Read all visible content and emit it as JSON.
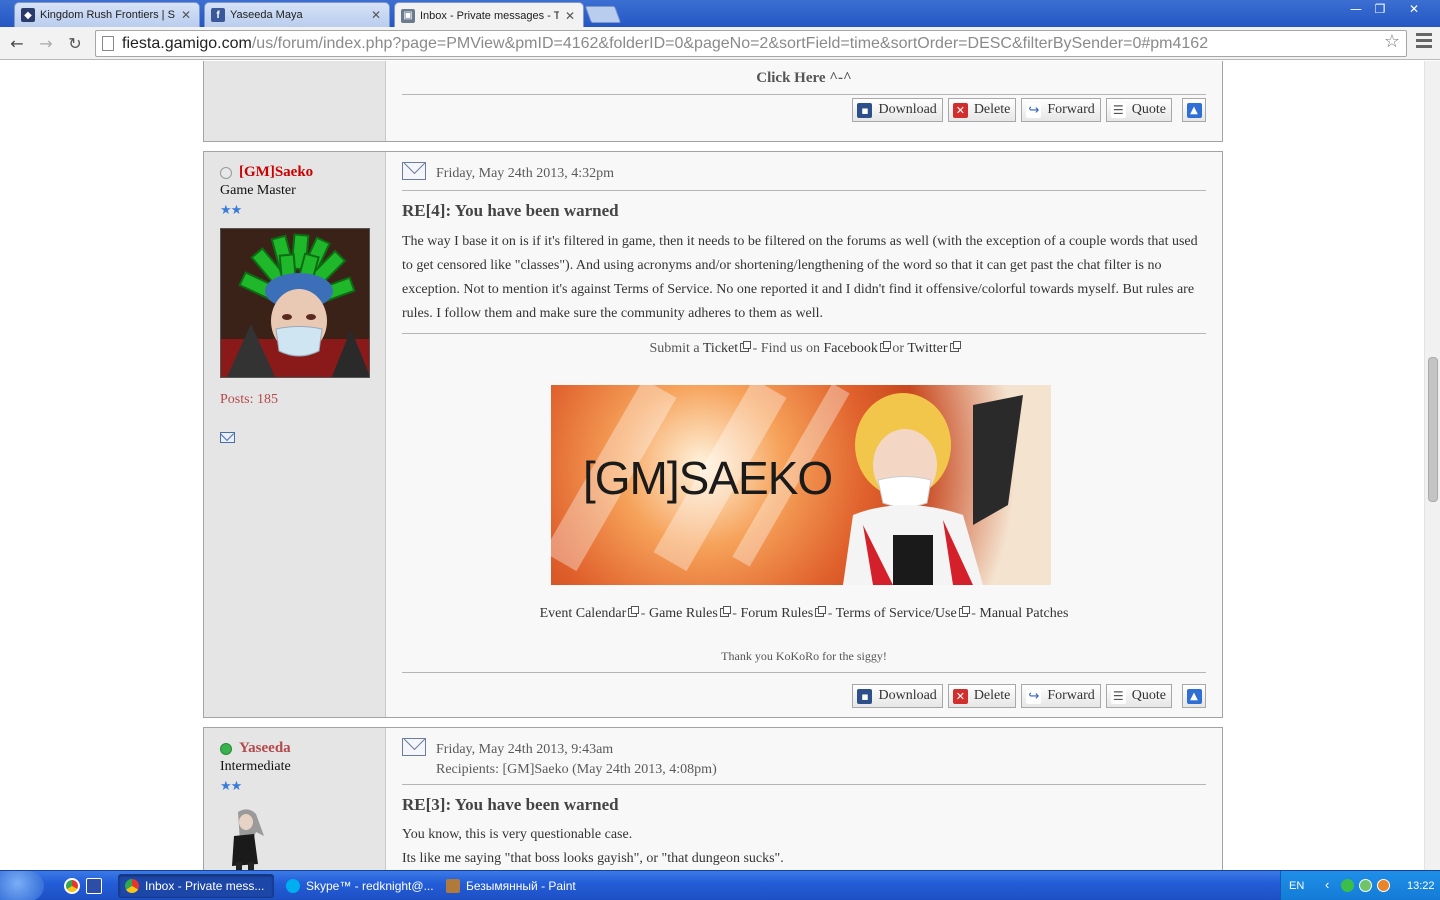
{
  "browser": {
    "tabs": [
      {
        "title": "Kingdom Rush Frontiers | Str",
        "favicon": "shield-icon",
        "active": false
      },
      {
        "title": "Yaseeda Maya",
        "favicon": "facebook-icon",
        "active": false
      },
      {
        "title": "Inbox - Private messages - T",
        "favicon": "forum-icon",
        "active": true
      }
    ],
    "url_host": "fiesta.gamigo.com",
    "url_path": "/us/forum/index.php?page=PMView&pmID=4162&folderID=0&pageNo=2&sortField=time&sortOrder=DESC&filterBySender=0#pm4162"
  },
  "top_post": {
    "link_text": "Click Here ^-^"
  },
  "actions": {
    "download": "Download",
    "delete": "Delete",
    "forward": "Forward",
    "quote": "Quote"
  },
  "posts": [
    {
      "author": "[GM]Saeko",
      "rank": "Game Master",
      "posts_label": "Posts: 185",
      "date": "Friday, May 24th 2013, 4:32pm",
      "subject": "RE[4]: You have been warned",
      "body": "The way I base it on is if it's filtered in game, then it needs to be filtered on the forums as well (with the exception of a couple words that used to get censored like \"classes\"). And using acronyms and/or shortening/lengthening of the word so that it can get past the chat filter is no exception. Not to mention it's against Terms of Service. No one reported it and I didn't find it offensive/colorful towards myself. But rules are rules. I follow them and make sure the community adheres to them as well.",
      "signature": {
        "submit_a": "Submit a",
        "ticket": "Ticket",
        "find_us_on": " - Find us on ",
        "facebook": "Facebook",
        "or": " or ",
        "twitter": "Twitter",
        "banner_text": "[GM]SAEKO",
        "links": [
          "Event Calendar",
          "Game Rules",
          "Forum Rules",
          "Terms of Service/Use",
          "Manual Patches"
        ],
        "thanks": "Thank you KoKoRo for the siggy!"
      }
    },
    {
      "author": "Yaseeda",
      "rank": "Intermediate",
      "date": "Friday, May 24th 2013, 9:43am",
      "recipients": "Recipients: [GM]Saeko (May 24th 2013, 4:08pm)",
      "subject": "RE[3]: You have been warned",
      "body_lines": [
        "You know, this is very questionable case.",
        "Its like me saying \"that boss looks gayish\", or \"that dungeon sucks\"."
      ]
    }
  ],
  "taskbar": {
    "items": [
      {
        "label": "Inbox - Private mess...",
        "active": true
      },
      {
        "label": "Skype™ - redknight@...",
        "active": false
      },
      {
        "label": "Безымянный - Paint",
        "active": false
      }
    ],
    "language": "EN",
    "clock": "13:22"
  },
  "colors": {
    "gm_name": "#cc0000",
    "user_name": "#b5484a",
    "online": "#37b24d",
    "offline": "#cfcfcf"
  }
}
